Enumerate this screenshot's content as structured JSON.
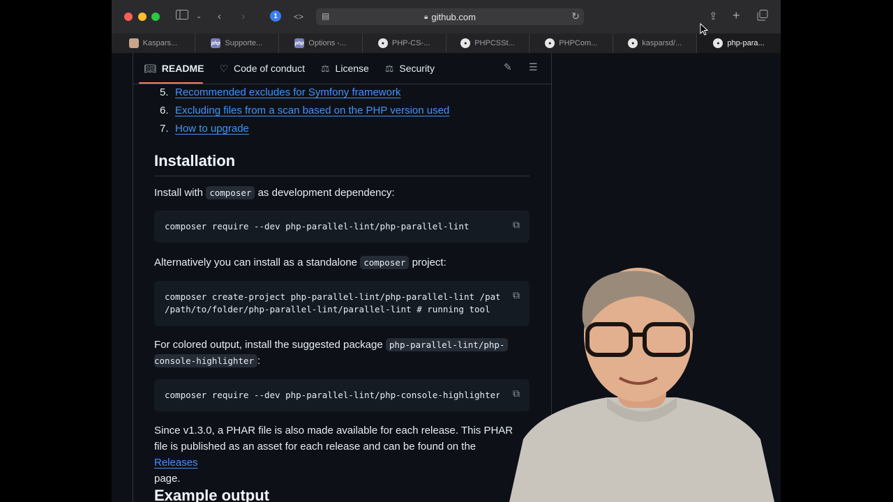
{
  "browser": {
    "url": "github.com",
    "tabs": [
      {
        "label": "Kaspars...",
        "favicon": "person"
      },
      {
        "label": "Supporte...",
        "favicon": "php"
      },
      {
        "label": "Options -...",
        "favicon": "php"
      },
      {
        "label": "PHP-CS-...",
        "favicon": "github"
      },
      {
        "label": "PHPCSSt...",
        "favicon": "github"
      },
      {
        "label": "PHPCom...",
        "favicon": "github"
      },
      {
        "label": "kasparsd/...",
        "favicon": "github"
      },
      {
        "label": "php-para...",
        "favicon": "github",
        "active": true
      }
    ]
  },
  "readme_nav": {
    "readme": "README",
    "code_of_conduct": "Code of conduct",
    "license": "License",
    "security": "Security"
  },
  "toc": [
    {
      "num": "5.",
      "label": "Recommended excludes for Symfony framework"
    },
    {
      "num": "6.",
      "label": "Excluding files from a scan based on the PHP version used"
    },
    {
      "num": "7.",
      "label": "How to upgrade"
    }
  ],
  "installation": {
    "heading": "Installation",
    "p1_before": "Install with",
    "p1_code": "composer",
    "p1_after": "as development dependency:",
    "code1": "composer require --dev php-parallel-lint/php-parallel-lint",
    "p2_before": "Alternatively you can install as a standalone",
    "p2_code": "composer",
    "p2_after": "project:",
    "code2": "composer create-project php-parallel-lint/php-parallel-lint /path/to/folder/php-parallel-lint\n/path/to/folder/php-parallel-lint/parallel-lint # running tool",
    "p3_before": "For colored output, install the suggested package",
    "p3_code_a": "php-parallel-lint/php-",
    "p3_code_b": "console-highlighter",
    "p3_after": ":",
    "code3": "composer require --dev php-parallel-lint/php-console-highlighter",
    "p4_before": "Since v1.3.0, a PHAR file is also made available for each release. This PHAR file is published as an asset for each release and can be found on the",
    "p4_link": "Releases",
    "p4_after": "page."
  },
  "next_heading": "Example output"
}
